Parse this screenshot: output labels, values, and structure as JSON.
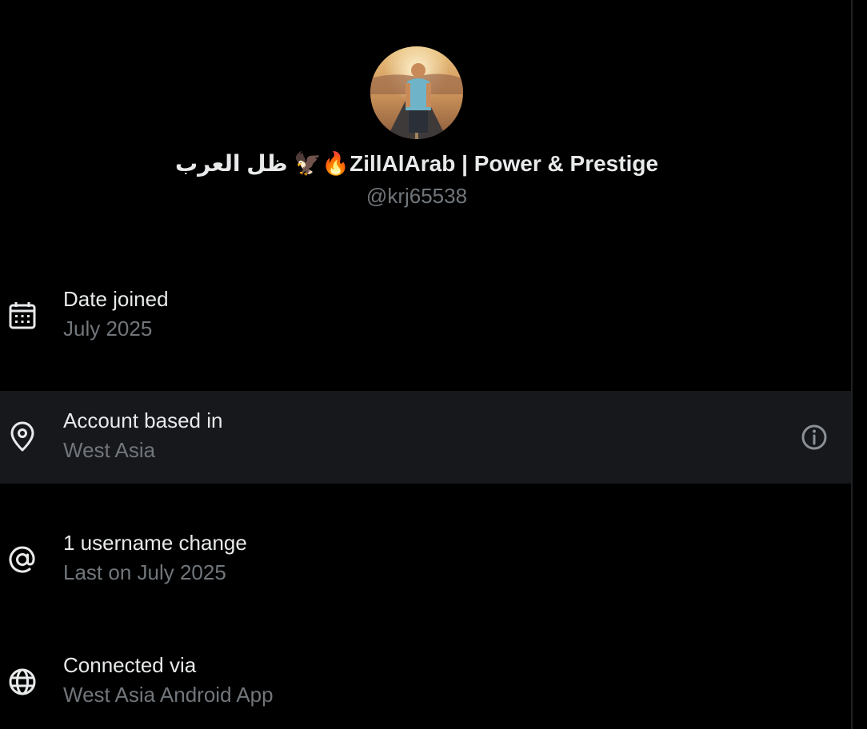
{
  "profile": {
    "display_name": "ظل العرب 🦅🔥ZillAlArab | Power & Prestige",
    "handle": "@krj65538"
  },
  "details": [
    {
      "icon": "calendar-icon",
      "title": "Date joined",
      "value": "July 2025"
    },
    {
      "icon": "location-pin-icon",
      "title": "Account based in",
      "value": "West Asia"
    },
    {
      "icon": "at-sign-icon",
      "title": "1 username change",
      "value": "Last on July 2025"
    },
    {
      "icon": "globe-icon",
      "title": "Connected via",
      "value": "West Asia Android App"
    }
  ],
  "colors": {
    "background": "#000000",
    "highlight_row": "#16181c",
    "primary_text": "#e7e9ea",
    "secondary_text": "#71767b"
  }
}
